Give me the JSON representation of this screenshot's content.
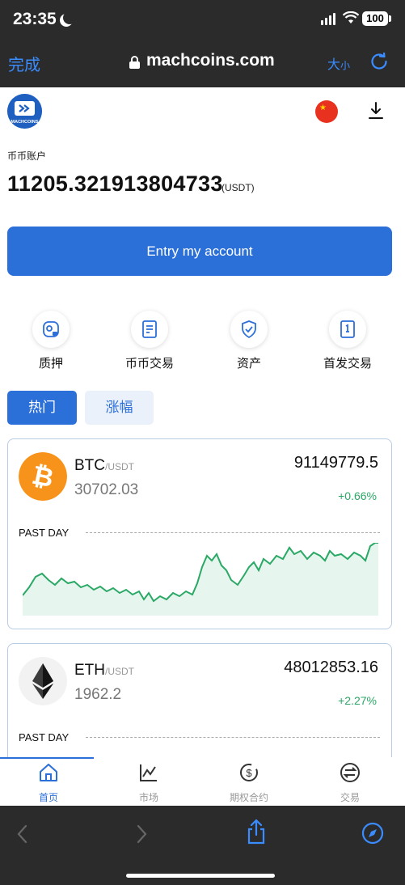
{
  "status": {
    "time": "23:35",
    "battery": "100"
  },
  "browser": {
    "done_label": "完成",
    "url": "machcoins.com",
    "size_big": "大",
    "size_small": "小"
  },
  "header": {
    "logo_text": "MACHCOINS"
  },
  "account": {
    "label": "币币账户",
    "balance": "11205.321913804733",
    "unit": "(USDT)"
  },
  "entry_button": "Entry my account",
  "quick_actions": [
    {
      "label": "质押",
      "icon": "pledge-icon"
    },
    {
      "label": "币币交易",
      "icon": "trade-icon"
    },
    {
      "label": "资产",
      "icon": "asset-shield-icon"
    },
    {
      "label": "首发交易",
      "icon": "ipo-icon"
    }
  ],
  "tabs": {
    "hot": "热门",
    "gain": "涨幅"
  },
  "coins": [
    {
      "symbol": "BTC",
      "pair": "/USDT",
      "sub_price": "30702.03",
      "price": "91149779.5",
      "change": "+0.66%",
      "past_day": "PAST DAY",
      "color": "#f7931a"
    },
    {
      "symbol": "ETH",
      "pair": "/USDT",
      "sub_price": "1962.2",
      "price": "48012853.16",
      "change": "+2.27%",
      "past_day": "PAST DAY",
      "color": "#3c3c3d"
    }
  ],
  "bottom_nav": [
    {
      "label": "首页",
      "icon": "home-icon",
      "active": true
    },
    {
      "label": "市场",
      "icon": "chart-icon",
      "active": false
    },
    {
      "label": "期权合约",
      "icon": "contract-icon",
      "active": false
    },
    {
      "label": "交易",
      "icon": "exchange-icon",
      "active": false
    }
  ],
  "colors": {
    "accent": "#2b6fd9",
    "positive": "#2aa865",
    "link": "#3a8cff"
  }
}
